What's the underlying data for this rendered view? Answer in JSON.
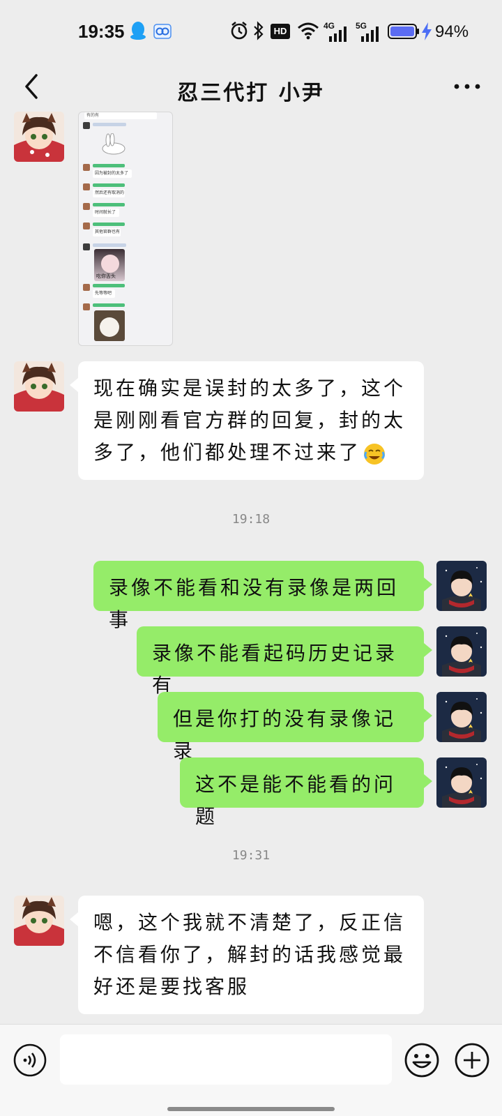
{
  "status_bar": {
    "time": "19:35",
    "battery_percent": "94%",
    "network_4g": "4G",
    "network_5g": "5G",
    "hd_badge": "HD"
  },
  "header": {
    "title": "忍三代打  小尹",
    "back_icon": "back-chevron-icon",
    "more_icon": "more-dots-icon"
  },
  "messages": [
    {
      "side": "in",
      "kind": "image",
      "description_icon": "chat-screenshot-image",
      "mini_texts": [
        "有的有",
        "因为被封的太多了",
        "然后还有取消的",
        "时间就长了",
        "其他官群也有",
        "先等等吧"
      ],
      "mini_caption": "吃你舌头"
    },
    {
      "side": "in",
      "kind": "text",
      "text": "现在确实是误封的太多了，这个是刚刚看官方群的回复，封的太多了，他们都处理不过来了"
    },
    {
      "kind": "time",
      "text": "19:18"
    },
    {
      "side": "out",
      "kind": "text",
      "text": "录像不能看和没有录像是两回事"
    },
    {
      "side": "out",
      "kind": "text",
      "text": "录像不能看起码历史记录有"
    },
    {
      "side": "out",
      "kind": "text",
      "text": "但是你打的没有录像记录"
    },
    {
      "side": "out",
      "kind": "text",
      "text": "这不是能不能看的问题"
    },
    {
      "kind": "time",
      "text": "19:31"
    },
    {
      "side": "in",
      "kind": "text",
      "text": "嗯，这个我就不清楚了，反正信不信看你了，解封的话我感觉最好还是要找客服"
    }
  ],
  "input_bar": {
    "placeholder": "",
    "value": ""
  },
  "colors": {
    "background": "#ededed",
    "outgoing_bubble": "#95ec69",
    "incoming_bubble": "#ffffff",
    "battery_fill": "#5b6cf2",
    "charging_bolt": "#4c6ef5",
    "qq_blue": "#1ea0f5"
  }
}
